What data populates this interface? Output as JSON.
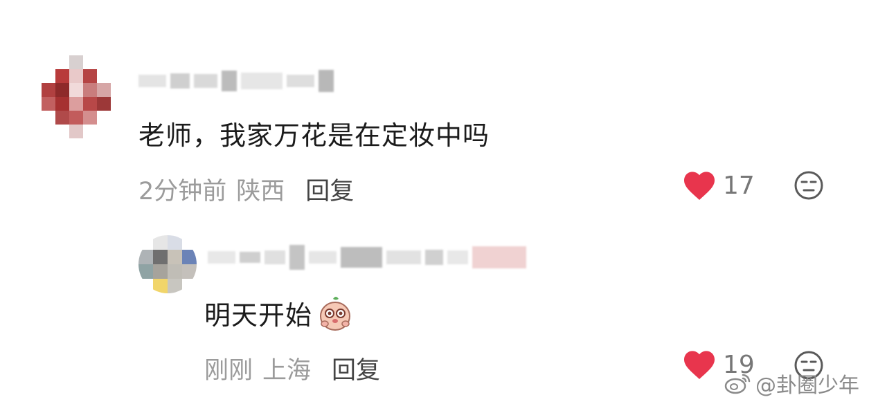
{
  "comment": {
    "text": "老师，我家万花是在定妆中吗",
    "time": "2分钟前",
    "location": "陕西",
    "reply_label": "回复",
    "like_count": "17"
  },
  "reply": {
    "text": "明天开始",
    "time": "刚刚",
    "location": "上海",
    "reply_label": "回复",
    "like_count": "19"
  },
  "watermark": {
    "text": "@卦圈少年",
    "icon": "weibo-icon"
  },
  "colors": {
    "heart": "#e8354d",
    "text": "#1b1b1b",
    "meta": "#9b9b9b"
  }
}
